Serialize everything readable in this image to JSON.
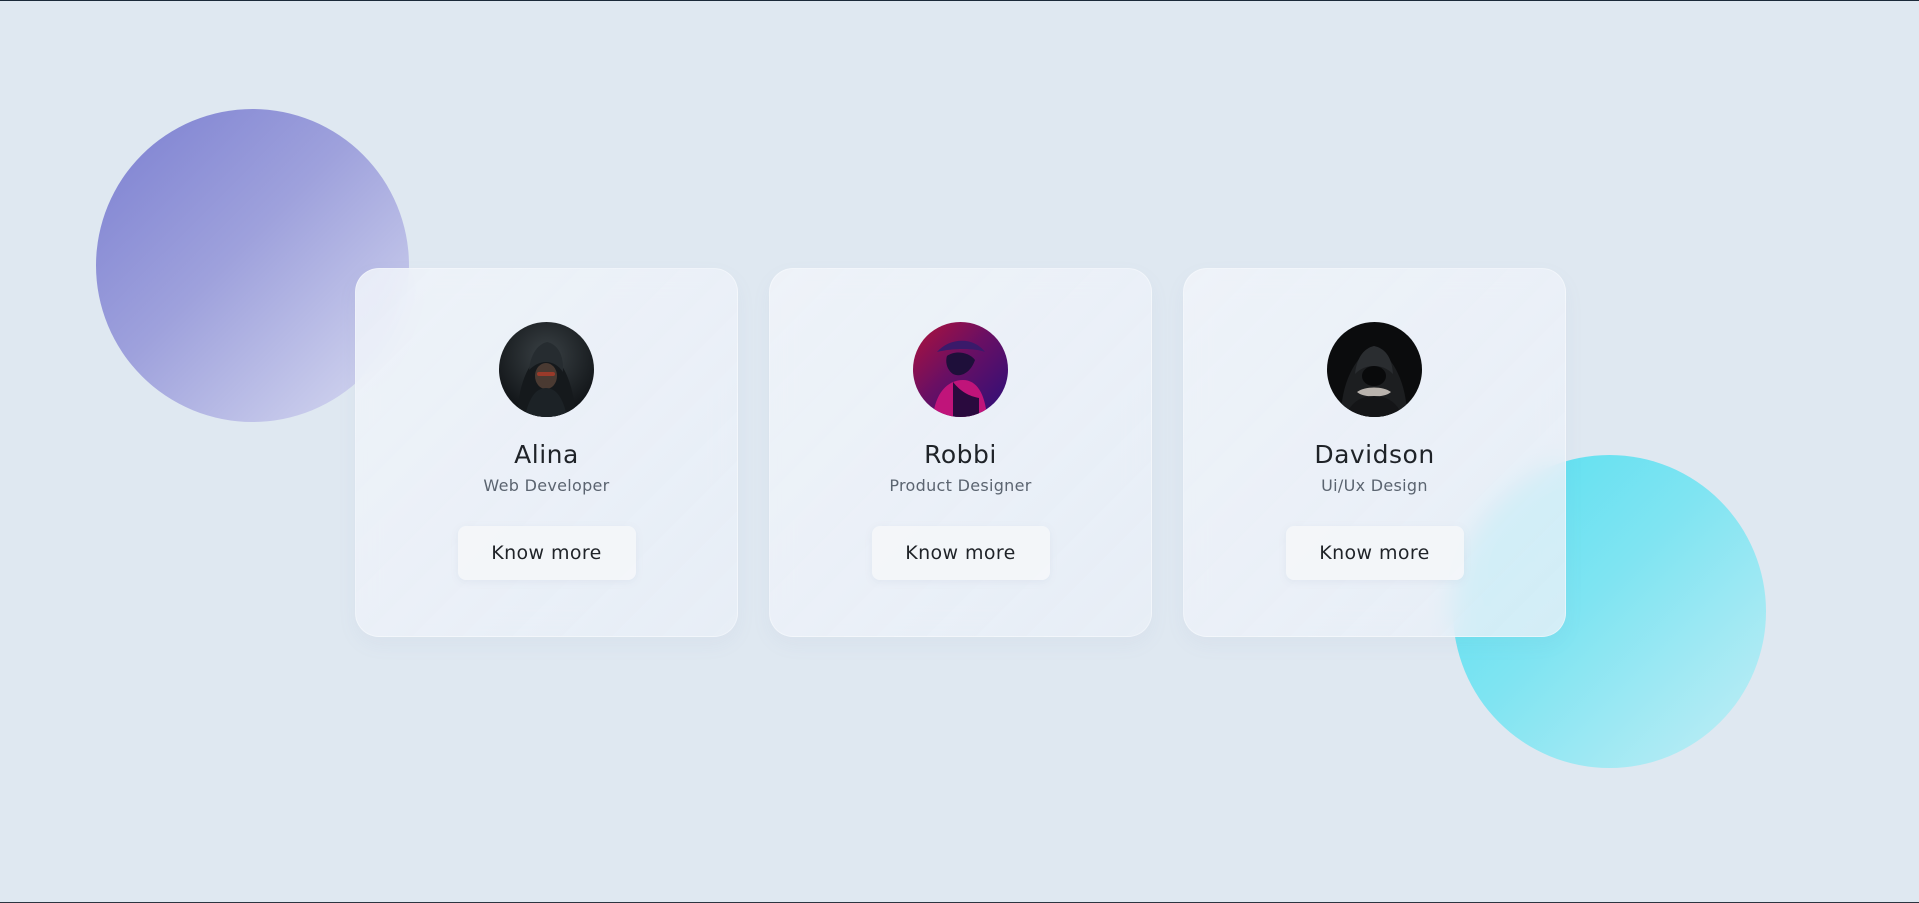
{
  "theme": {
    "background": "#dfe8f1",
    "blob_left": "#7b7fd1",
    "blob_right": "#55dff0",
    "text_primary": "#1f2328",
    "text_secondary": "#5b6470"
  },
  "profiles": [
    {
      "name": "Alina",
      "role": "Web Developer",
      "button_label": "Know more",
      "avatar_icon": "hooded-person-avatar"
    },
    {
      "name": "Robbi",
      "role": "Product Designer",
      "button_label": "Know more",
      "avatar_icon": "hooded-person-avatar"
    },
    {
      "name": "Davidson",
      "role": "Ui/Ux Design",
      "button_label": "Know more",
      "avatar_icon": "hooded-person-avatar"
    }
  ]
}
